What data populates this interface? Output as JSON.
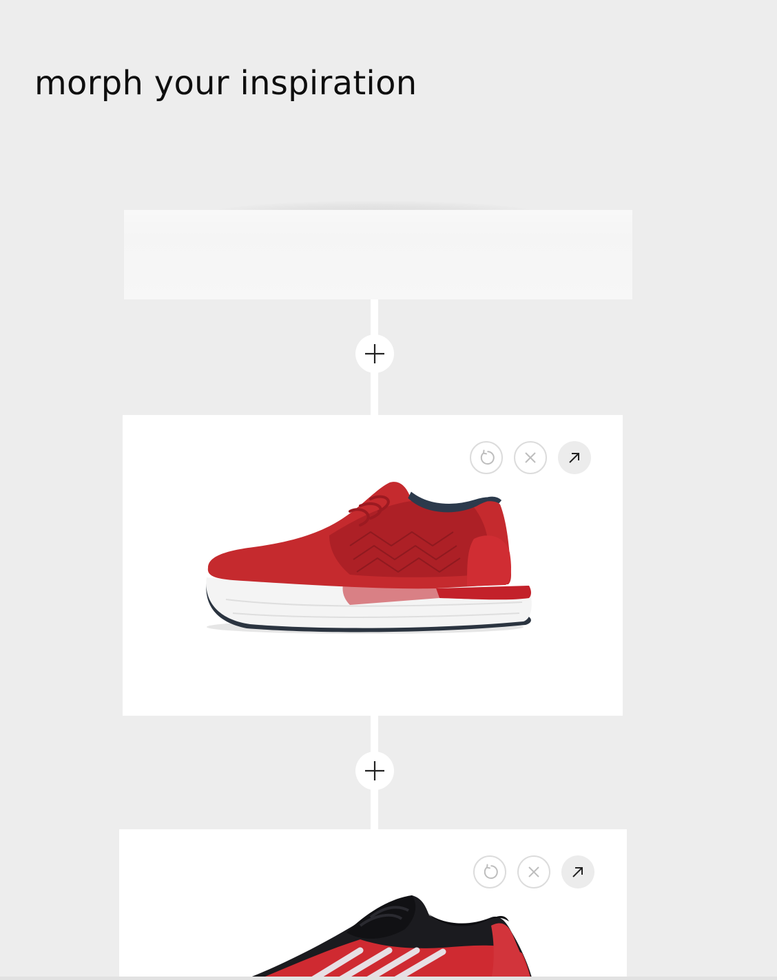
{
  "page": {
    "title": "morph your inspiration"
  },
  "colors": {
    "background": "#ededed",
    "card": "#ffffff",
    "shoe_red": "#c8262b",
    "shoe_collar": "#2c3a4c"
  },
  "cards": [
    {
      "name": "placeholder-card",
      "state": "loading"
    },
    {
      "name": "red-knit-sneaker",
      "actions": [
        {
          "name": "regenerate",
          "icon": "refresh-icon"
        },
        {
          "name": "remove",
          "icon": "close-icon"
        },
        {
          "name": "open",
          "icon": "arrow-up-right-icon"
        }
      ]
    },
    {
      "name": "red-black-striped-sneaker",
      "actions": [
        {
          "name": "regenerate",
          "icon": "refresh-icon"
        },
        {
          "name": "remove",
          "icon": "close-icon"
        },
        {
          "name": "open",
          "icon": "arrow-up-right-icon"
        }
      ]
    }
  ],
  "add_buttons": [
    {
      "icon": "plus-icon"
    },
    {
      "icon": "plus-icon"
    }
  ]
}
